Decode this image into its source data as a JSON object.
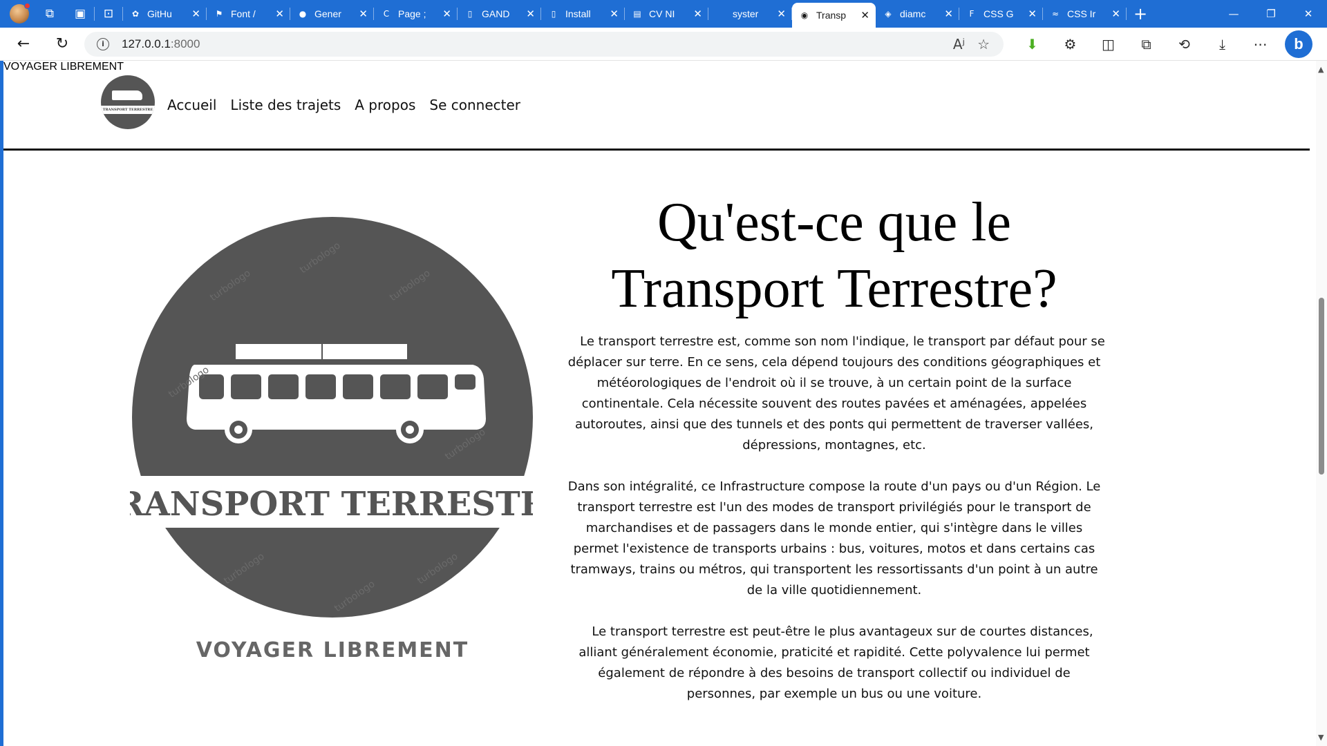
{
  "browser": {
    "tabs": [
      {
        "label": "GitHu",
        "icon": "openai-icon",
        "active": false
      },
      {
        "label": "Font /",
        "icon": "flag-icon",
        "active": false
      },
      {
        "label": "Gener",
        "icon": "github-icon",
        "active": false
      },
      {
        "label": "Page ;",
        "icon": "canva-icon",
        "active": false
      },
      {
        "label": "GAND",
        "icon": "document-icon",
        "active": false
      },
      {
        "label": "Install",
        "icon": "document-icon",
        "active": false
      },
      {
        "label": "CV NI",
        "icon": "pdf-icon",
        "active": false
      },
      {
        "label": "syster",
        "icon": "blank-icon",
        "active": false
      },
      {
        "label": "Transp",
        "icon": "globe-icon",
        "active": true
      },
      {
        "label": "diamc",
        "icon": "codepen-icon",
        "active": false
      },
      {
        "label": "CSS G",
        "icon": "f-icon",
        "active": false
      },
      {
        "label": "CSS Ir",
        "icon": "tailwind-icon",
        "active": false
      }
    ],
    "url_host": "127.0.0.1",
    "url_port": ":8000"
  },
  "site": {
    "logo_text": "TRANSPORT TERRESTRE",
    "logo_tagline": "VOYAGER LIBREMENT",
    "nav": {
      "home": "Accueil",
      "trips": "Liste des trajets",
      "about": "A propos",
      "login": "Se connecter"
    }
  },
  "hero": {
    "title_line1": "Qu'est-ce que le",
    "title_line2": "Transport Terrestre?",
    "paragraph1": "Le transport terrestre est, comme son nom l'indique, le transport par défaut pour se déplacer sur terre. En ce sens, cela dépend toujours des conditions géographiques et météorologiques de l'endroit où il se trouve, à un certain point de la surface continentale. Cela nécessite souvent des routes pavées et aménagées, appelées autoroutes, ainsi que des tunnels et des ponts qui permettent de traverser vallées, dépressions, montagnes, etc.",
    "paragraph2": "Dans son intégralité, ce Infrastructure compose la route d'un pays ou d'un Région. Le transport terrestre est l'un des modes de transport privilégiés pour le transport de marchandises et de passagers dans le monde entier, qui s'intègre dans le villes permet l'existence de transports urbains : bus, voitures, motos et dans certains cas tramways, trains ou métros, qui transportent les ressortissants d'un point à un autre de la ville quotidiennement.",
    "paragraph3": "Le transport terrestre est peut-être le plus avantageux sur de courtes distances, alliant généralement économie, praticité et rapidité. Cette polyvalence lui permet également de répondre à des besoins de transport collectif ou individuel de personnes, par exemple un bus ou une voiture."
  },
  "logo_watermark": "turbologo"
}
